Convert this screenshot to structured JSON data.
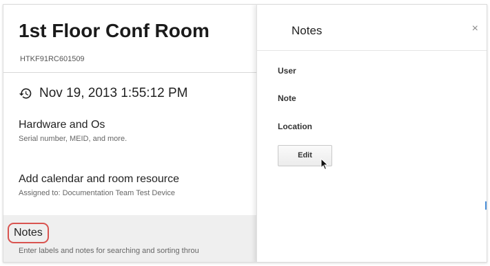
{
  "device": {
    "title": "1st Floor Conf Room",
    "serial_id": "HTKF91RC601509",
    "last_sync": "Nov 19, 2013 1:55:12 PM",
    "last_sync_icon": "history-icon"
  },
  "sections": {
    "hardware": {
      "label": "Hardware and Os",
      "subtitle": "Serial number, MEID, and more."
    },
    "calendar": {
      "label": "Add calendar and room resource",
      "subtitle": "Assigned to: Documentation Team Test Device"
    },
    "notes": {
      "label": "Notes",
      "subtitle": "Enter labels and notes for searching and sorting throu"
    }
  },
  "panel": {
    "title": "Notes",
    "close_label": "×",
    "fields": {
      "user": "User",
      "note": "Note",
      "location": "Location"
    },
    "edit_label": "Edit"
  },
  "colors": {
    "highlight_outline": "#d9534f",
    "selected_row_bg": "#efefef",
    "scroll_indicator": "#4a8fd8"
  }
}
